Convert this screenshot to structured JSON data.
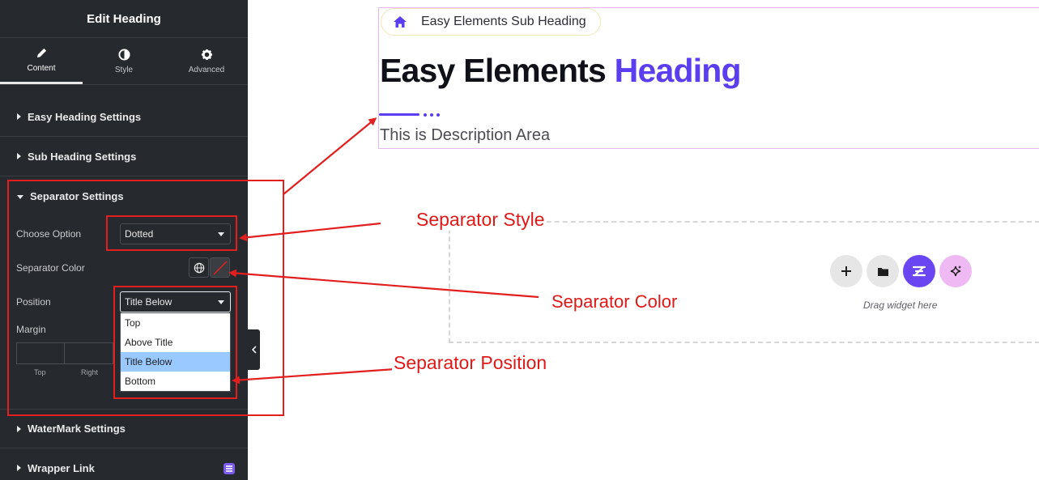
{
  "panel": {
    "title": "Edit Heading",
    "tabs": [
      {
        "label": "Content",
        "icon": "pencil-icon",
        "active": true
      },
      {
        "label": "Style",
        "icon": "half-circle-icon",
        "active": false
      },
      {
        "label": "Advanced",
        "icon": "gear-icon",
        "active": false
      }
    ],
    "sections": {
      "easy_heading": "Easy Heading Settings",
      "sub_heading": "Sub Heading Settings",
      "separator": "Separator Settings",
      "watermark": "WaterMark Settings",
      "wrapper_link": "Wrapper Link"
    },
    "separator_controls": {
      "choose_option_label": "Choose Option",
      "choose_option_value": "Dotted",
      "color_label": "Separator Color",
      "position_label": "Position",
      "position_value": "Title Below",
      "position_options": [
        "Top",
        "Above Title",
        "Title Below",
        "Bottom"
      ],
      "margin_label": "Margin",
      "margin_sides": [
        "Top",
        "Right"
      ]
    }
  },
  "canvas": {
    "sub_heading": "Easy Elements Sub Heading",
    "heading_main": "Easy Elements",
    "heading_accent": "Heading",
    "description": "This is Description Area",
    "drag_hint": "Drag widget here",
    "accent_color": "#5a3ef0"
  },
  "annotations": {
    "separator_style": "Separator Style",
    "separator_color": "Separator Color",
    "separator_position": "Separator Position",
    "color": "#e01818"
  }
}
